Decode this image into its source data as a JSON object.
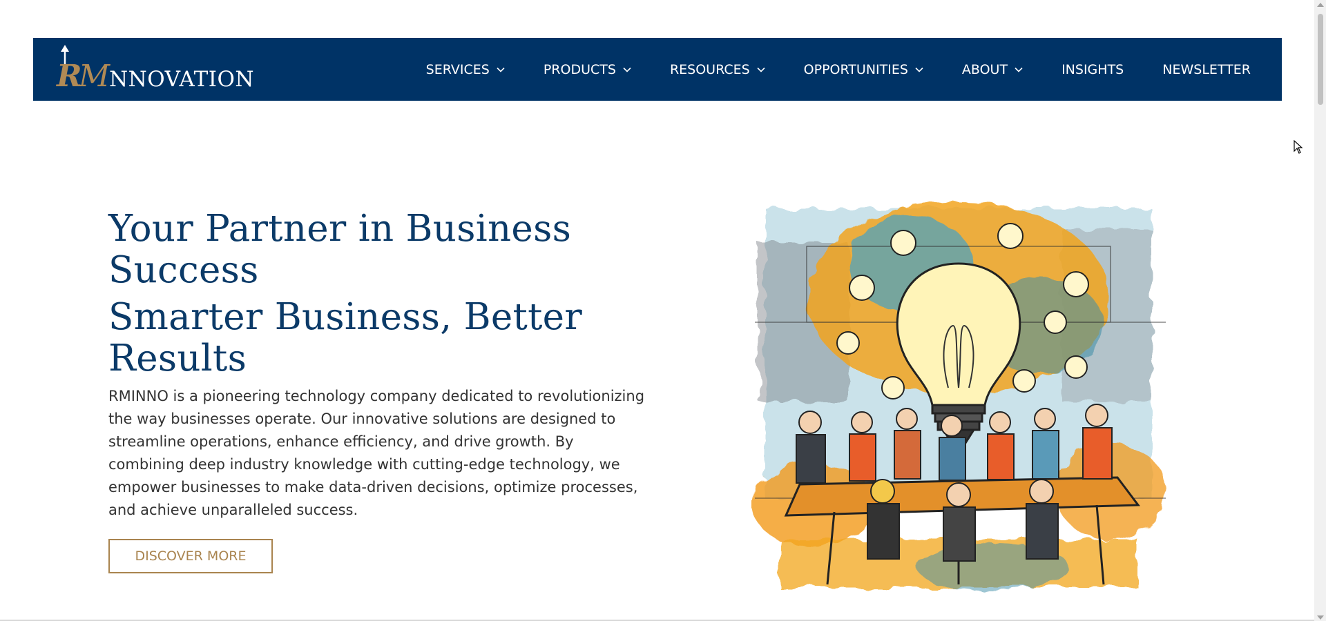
{
  "header": {
    "logo": {
      "monogram": "RM",
      "word": "NNOVATION",
      "alt": "RMINNOVATION"
    },
    "nav": [
      {
        "label": "SERVICES",
        "dropdown": true
      },
      {
        "label": "PRODUCTS",
        "dropdown": true
      },
      {
        "label": "RESOURCES",
        "dropdown": true
      },
      {
        "label": "OPPORTUNITIES",
        "dropdown": true
      },
      {
        "label": "ABOUT",
        "dropdown": true
      },
      {
        "label": "INSIGHTS",
        "dropdown": false
      },
      {
        "label": "NEWSLETTER",
        "dropdown": false
      }
    ]
  },
  "hero": {
    "title1": "Your Partner in Business Success",
    "title2": "Smarter Business, Better Results",
    "body": "RMINNO is a pioneering technology company dedicated to revolutionizing the way businesses operate. Our innovative solutions are designed to streamline operations, enhance efficiency, and drive growth. By combining deep industry knowledge with cutting-edge technology, we empower businesses to make data-driven decisions, optimize processes, and achieve unparalleled success.",
    "cta": "DISCOVER MORE",
    "image_icon": "lightbulb-team-illustration"
  },
  "colors": {
    "navy": "#003366",
    "title": "#0b3a68",
    "gold": "#a9844f",
    "text": "#333333"
  }
}
